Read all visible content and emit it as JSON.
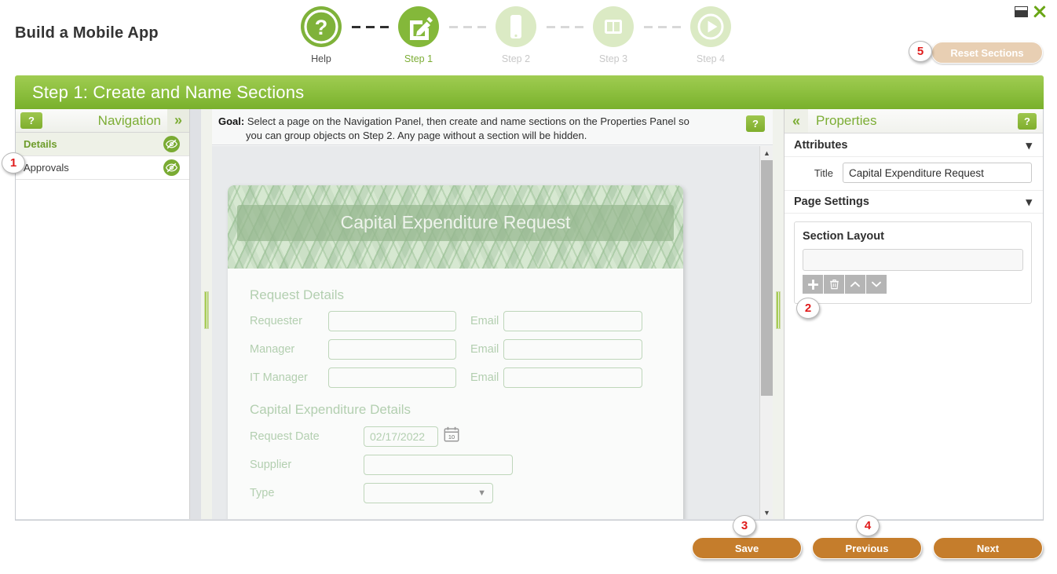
{
  "app": {
    "title": "Build a Mobile App",
    "window_controls": {
      "restore": "restore-icon",
      "close": "close-icon"
    }
  },
  "stepper": {
    "steps": [
      {
        "label": "Help",
        "icon": "question-mark-icon",
        "state": "help"
      },
      {
        "label": "Step 1",
        "icon": "pencil-edit-icon",
        "state": "current"
      },
      {
        "label": "Step 2",
        "icon": "mobile-phone-icon",
        "state": "future"
      },
      {
        "label": "Step 3",
        "icon": "columns-layout-icon",
        "state": "future"
      },
      {
        "label": "Step 4",
        "icon": "play-circle-icon",
        "state": "future"
      }
    ]
  },
  "step_header": {
    "title": "Step 1: Create and Name Sections"
  },
  "reset": {
    "label": "Reset Sections",
    "badge": "5"
  },
  "navigation": {
    "help_label": "?",
    "title": "Navigation",
    "collapse_icon": "chevron-double-right-icon",
    "badge": "1",
    "items": [
      {
        "label": "Details",
        "hidden_icon": "eye-slash-icon",
        "selected": true
      },
      {
        "label": "Approvals",
        "hidden_icon": "eye-slash-icon",
        "selected": false
      }
    ]
  },
  "goal": {
    "prefix": "Goal:",
    "line1": "Select a page on the Navigation Panel, then create and name sections on the Properties Panel so",
    "line2": "you can group objects on Step 2. Any page without a section will be hidden.",
    "help_label": "?"
  },
  "preview": {
    "banner_title": "Capital Expenditure Request",
    "sections": [
      {
        "heading": "Request Details",
        "rows": [
          {
            "label": "Requester",
            "value": "",
            "second_label": "Email",
            "second_value": ""
          },
          {
            "label": "Manager",
            "value": "",
            "second_label": "Email",
            "second_value": ""
          },
          {
            "label": "IT Manager",
            "value": "",
            "second_label": "Email",
            "second_value": ""
          }
        ]
      },
      {
        "heading": "Capital Expenditure Details",
        "rows": [
          {
            "label": "Request Date",
            "value": "02/17/2022",
            "control": "date-picker"
          },
          {
            "label": "Supplier",
            "value": "",
            "control": "text"
          },
          {
            "label": "Type",
            "value": "",
            "control": "dropdown"
          }
        ]
      }
    ],
    "scrollbar": {
      "up_icon": "triangle-up-icon",
      "down_icon": "triangle-down-icon"
    }
  },
  "properties": {
    "back_icon": "chevron-double-left-icon",
    "title": "Properties",
    "help_label": "?",
    "attributes": {
      "header": "Attributes",
      "caret": "chevron-down-icon",
      "title_label": "Title",
      "title_value": "Capital Expenditure Request"
    },
    "page_settings": {
      "header": "Page Settings",
      "caret": "chevron-down-icon"
    },
    "section_layout": {
      "header": "Section Layout",
      "list_value": "",
      "badge": "2",
      "tools": [
        {
          "name": "add-section-button",
          "icon": "plus-icon"
        },
        {
          "name": "delete-section-button",
          "icon": "trash-icon"
        },
        {
          "name": "move-section-up-button",
          "icon": "chevron-up-icon"
        },
        {
          "name": "move-section-down-button",
          "icon": "chevron-down-icon"
        }
      ]
    }
  },
  "footer": {
    "save": {
      "label": "Save",
      "badge": "3"
    },
    "previous": {
      "label": "Previous",
      "badge": "4"
    },
    "next": {
      "label": "Next",
      "badge": ""
    }
  },
  "colors": {
    "green_primary": "#7cad35",
    "green_header_light": "#a0cc52",
    "green_header_dark": "#79b02c",
    "orange_button": "#c57d2c",
    "reset_disabled": "#e8cfb3",
    "badge_red": "#e01b1b",
    "panel_bg": "#dfe1e5",
    "preview_label_green": "#b3cfb0"
  }
}
